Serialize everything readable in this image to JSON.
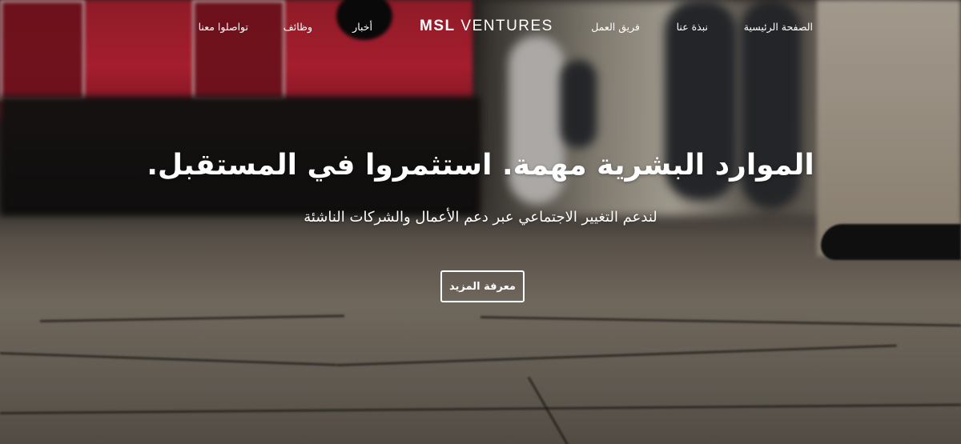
{
  "brand": {
    "bold": "MSL",
    "light": "VENTURES"
  },
  "nav": {
    "home": "الصفحة الرئيسية",
    "about": "نبذة عنا",
    "team": "فريق العمل",
    "news": "أخبار",
    "jobs": "وظائف",
    "contact": "تواصلوا معنا"
  },
  "hero": {
    "headline": "الموارد البشرية مهمة. استثمروا في المستقبل.",
    "subheadline": "لندعم التغيير الاجتماعي عبر دعم الأعمال والشركات الناشئة",
    "cta_label": "معرفة المزيد"
  },
  "colors": {
    "text": "#ffffff",
    "tram_red": "#c22437"
  }
}
